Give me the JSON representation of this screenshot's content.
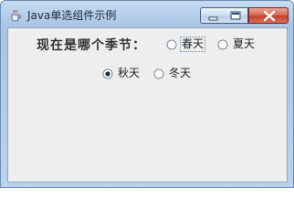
{
  "window": {
    "title": "Java单选组件示例"
  },
  "form": {
    "question": "现在是哪个季节：",
    "options": [
      {
        "label": "春天",
        "selected": false,
        "focused": true
      },
      {
        "label": "夏天",
        "selected": false,
        "focused": false
      },
      {
        "label": "秋天",
        "selected": true,
        "focused": false
      },
      {
        "label": "冬天",
        "selected": false,
        "focused": false
      }
    ]
  }
}
